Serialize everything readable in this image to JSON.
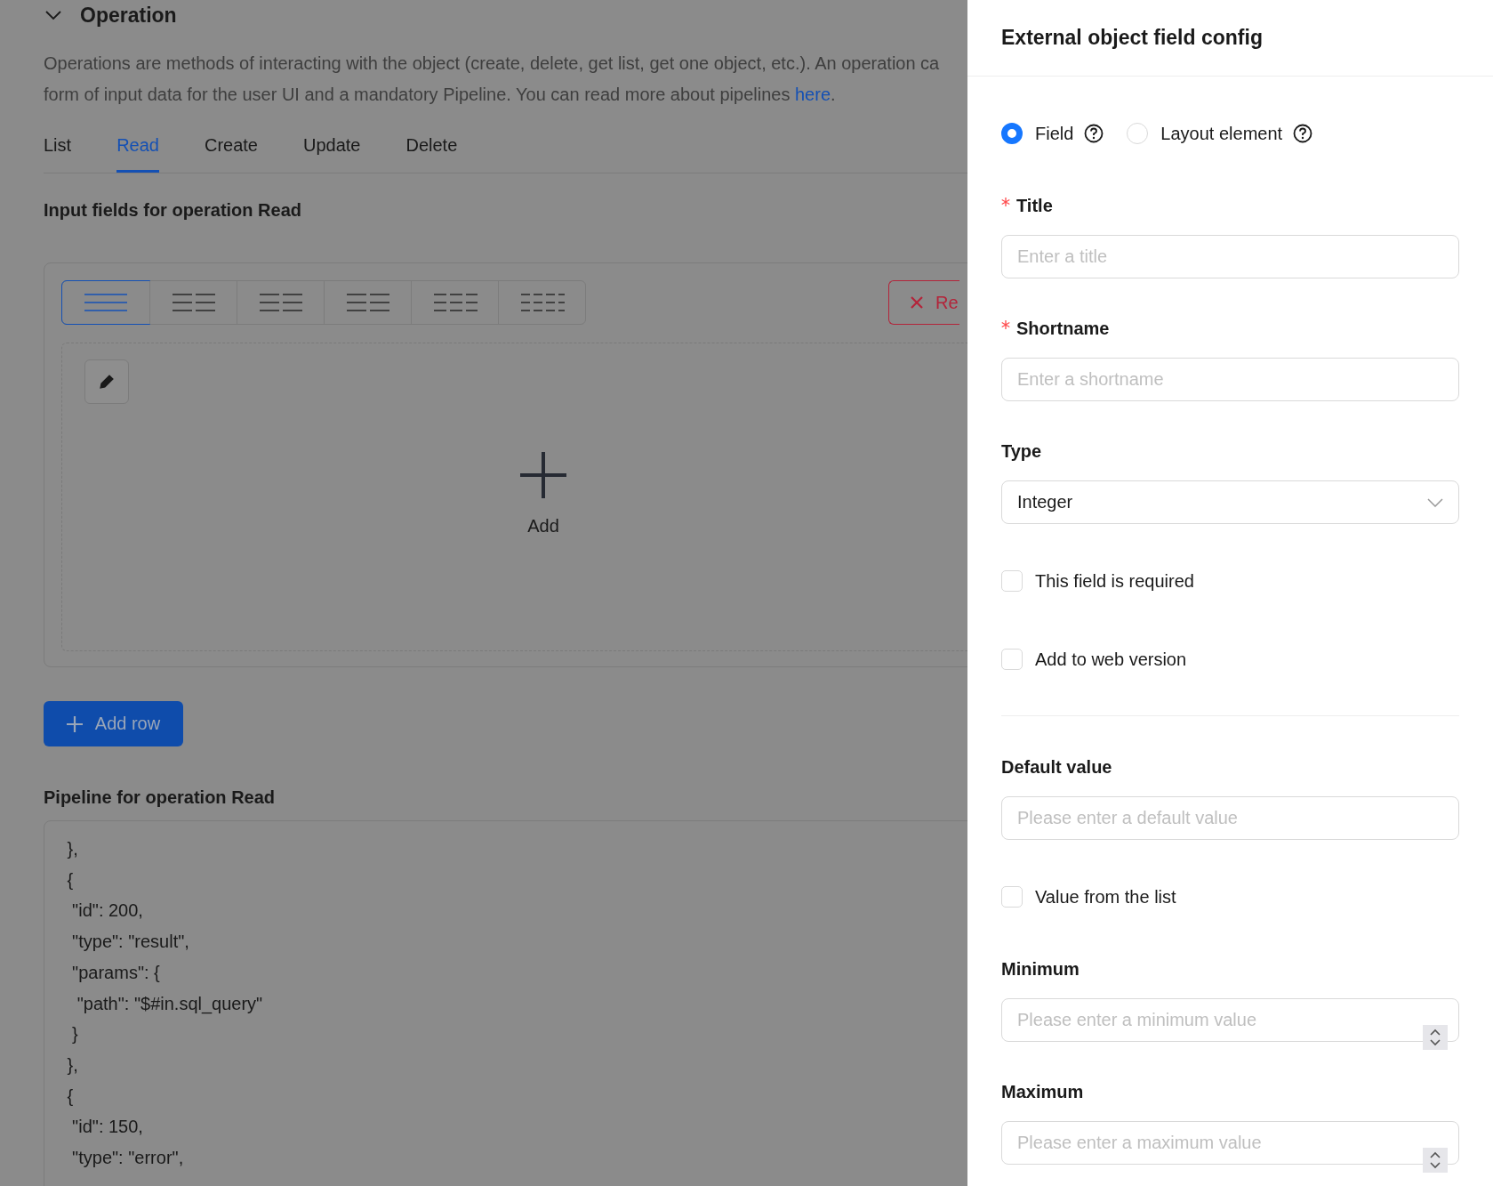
{
  "section": {
    "title": "Operation",
    "expanded": true,
    "description": {
      "line1": "Operations are methods of interacting with the object (create, delete, get list, get one object, etc.). An operation ca",
      "line2": "form of input data for the user UI and a mandatory Pipeline. You can read more about pipelines ",
      "link": "here",
      "after": "."
    }
  },
  "tabs": [
    {
      "label": "List",
      "selected": false
    },
    {
      "label": "Read",
      "selected": true
    },
    {
      "label": "Create",
      "selected": false
    },
    {
      "label": "Update",
      "selected": false
    },
    {
      "label": "Delete",
      "selected": false
    }
  ],
  "input_fields": {
    "heading": "Input fields for operation Read",
    "layouts": [
      {
        "kind": "full",
        "selected": true
      },
      {
        "kind": "halves",
        "selected": false
      },
      {
        "kind": "wide-narrow",
        "selected": false
      },
      {
        "kind": "narrow-wide",
        "selected": false
      },
      {
        "kind": "thirds",
        "selected": false
      },
      {
        "kind": "quarters",
        "selected": false
      }
    ],
    "remove_button": "Re",
    "add_label": "Add"
  },
  "add_row_button": "Add row",
  "pipeline": {
    "heading": "Pipeline for operation Read",
    "code_lines": [
      " },",
      " {",
      "  \"id\": 200,",
      "  \"type\": \"result\",",
      "  \"params\": {",
      "   \"path\": \"$#in.sql_query\"",
      "  }",
      " },",
      " {",
      "  \"id\": 150,",
      "  \"type\": \"error\","
    ]
  },
  "drawer": {
    "title": "External object field config",
    "options": [
      {
        "label": "Field",
        "selected": true
      },
      {
        "label": "Layout element",
        "selected": false
      }
    ],
    "fields": [
      {
        "kind": "text",
        "label": "Title",
        "required": true,
        "placeholder": "Enter a title"
      },
      {
        "kind": "text",
        "label": "Shortname",
        "required": true,
        "placeholder": "Enter a shortname"
      },
      {
        "kind": "select",
        "label": "Type",
        "required": false,
        "value": "Integer"
      },
      {
        "kind": "checkbox",
        "label": "This field is required",
        "checked": false
      },
      {
        "kind": "checkbox",
        "label": "Add to web version",
        "checked": false
      },
      {
        "kind": "divider"
      },
      {
        "kind": "text",
        "label": "Default value",
        "required": false,
        "placeholder": "Please enter a default value"
      },
      {
        "kind": "checkbox",
        "label": "Value from the list",
        "checked": false
      },
      {
        "kind": "number",
        "label": "Minimum",
        "required": false,
        "placeholder": "Please enter a minimum value"
      },
      {
        "kind": "number",
        "label": "Maximum",
        "required": false,
        "placeholder": "Please enter a maximum value"
      }
    ]
  }
}
